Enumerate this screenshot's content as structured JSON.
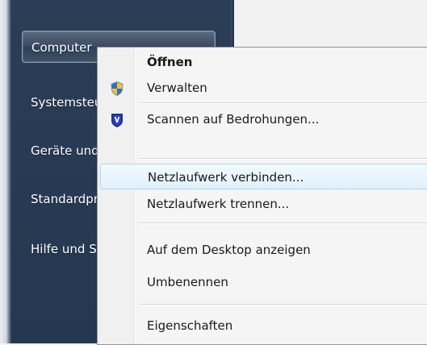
{
  "start_menu": {
    "items": [
      {
        "label": "Computer",
        "selected": true
      },
      {
        "label": "Systemsteuerung",
        "selected": false
      },
      {
        "label": "Geräte und Drucker",
        "selected": false
      },
      {
        "label": "Standardprogramme",
        "selected": false
      },
      {
        "label": "Hilfe und Support",
        "selected": false
      }
    ]
  },
  "context_menu": {
    "items": {
      "open": "Öffnen",
      "manage": "Verwalten",
      "scan": "Scannen auf Bedrohungen...",
      "map_drive": "Netzlaufwerk verbinden...",
      "disconnect_drive": "Netzlaufwerk trennen...",
      "show_on_desktop": "Auf dem Desktop anzeigen",
      "rename": "Umbenennen",
      "properties": "Eigenschaften"
    },
    "icons": {
      "manage": "uac-shield-icon",
      "scan": "antivirus-shield-icon"
    },
    "hovered_item": "map_drive",
    "colors": {
      "hover_border": "#a8d8f7",
      "hover_fill": "#e0f1fd",
      "start_pane": "#283b54"
    }
  }
}
